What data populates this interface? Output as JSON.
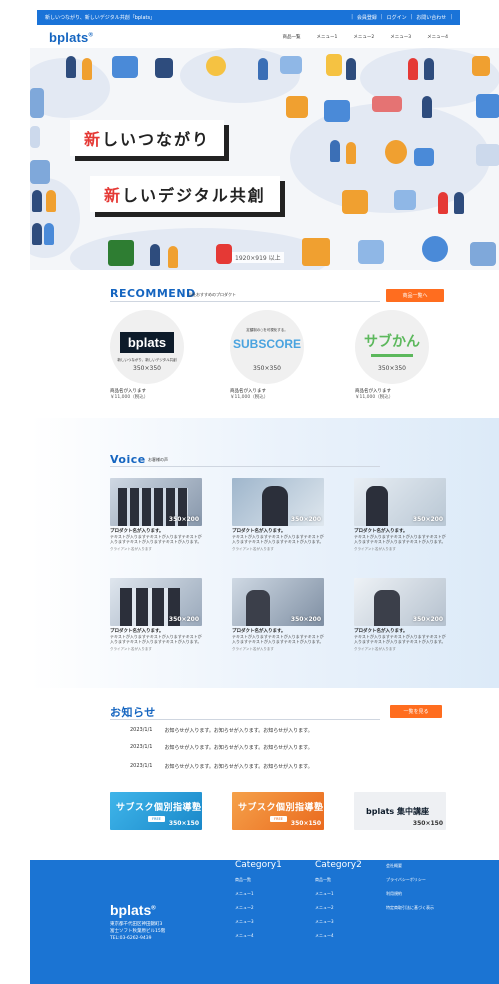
{
  "topbar": {
    "tagline": "新しいつながり、新しいデジタル共創「bplats」",
    "links": [
      "会員登録",
      "ログイン",
      "お問い合わせ"
    ]
  },
  "nav": {
    "logo": "bplats",
    "logo_mark": "®",
    "items": [
      "商品一覧",
      "メニュー1",
      "メニュー2",
      "メニュー3",
      "メニュー4"
    ]
  },
  "hero": {
    "headline1_accent": "新",
    "headline1_rest": "しいつながり",
    "headline2_accent": "新",
    "headline2_rest": "しいデジタル共創",
    "dimension": "1920×919 以上"
  },
  "recommend": {
    "title": "RECOMMEND",
    "subtitle": "当社おすすめのプロダクト",
    "button": "商品一覧へ",
    "products": [
      {
        "label": "bplats",
        "sub": "新しいつながり、新しいデジタル共創",
        "size": "350×350",
        "name": "商品名が入ります",
        "price": "￥11,000（税込）"
      },
      {
        "label": "SUBSCORE",
        "sub": "定額制の○を可視化する。",
        "size": "350×350",
        "name": "商品名が入ります",
        "price": "￥11,000（税込）"
      },
      {
        "label": "サブかん",
        "sub": "",
        "size": "350×350",
        "name": "商品名が入ります",
        "price": "￥11,000（税込）"
      }
    ]
  },
  "voice": {
    "title": "Voice",
    "subtitle": "お客様の声",
    "cards": [
      {
        "size": "350×200",
        "title": "プロダクト名が入ります。",
        "text": "テキストが入りますテキストが入りますテキストが入りますテキストが入りますテキストが入ります。",
        "category": "クライアント名が入ります"
      },
      {
        "size": "350×200",
        "title": "プロダクト名が入ります。",
        "text": "テキストが入りますテキストが入りますテキストが入りますテキストが入りますテキストが入ります。",
        "category": "クライアント名が入ります"
      },
      {
        "size": "350×200",
        "title": "プロダクト名が入ります。",
        "text": "テキストが入りますテキストが入りますテキストが入りますテキストが入りますテキストが入ります。",
        "category": "クライアント名が入ります"
      },
      {
        "size": "350×200",
        "title": "プロダクト名が入ります。",
        "text": "テキストが入りますテキストが入りますテキストが入りますテキストが入りますテキストが入ります。",
        "category": "クライアント名が入ります"
      },
      {
        "size": "350×200",
        "title": "プロダクト名が入ります。",
        "text": "テキストが入りますテキストが入りますテキストが入りますテキストが入りますテキストが入ります。",
        "category": "クライアント名が入ります"
      },
      {
        "size": "350×200",
        "title": "プロダクト名が入ります。",
        "text": "テキストが入りますテキストが入りますテキストが入りますテキストが入りますテキストが入ります。",
        "category": "クライアント名が入ります"
      }
    ]
  },
  "news": {
    "title": "お知らせ",
    "button": "一覧を見る",
    "items": [
      {
        "date": "2023/1/1",
        "text": "お知らせが入ります。お知らせが入ります。お知らせが入ります。"
      },
      {
        "date": "2023/1/1",
        "text": "お知らせが入ります。お知らせが入ります。お知らせが入ります。"
      },
      {
        "date": "2023/1/1",
        "text": "お知らせが入ります。お知らせが入ります。お知らせが入ります。"
      }
    ]
  },
  "banners": [
    {
      "text": "サブスク個別指導塾",
      "pill": "FREE",
      "size": "350×150",
      "color": "#22a3dc"
    },
    {
      "text": "サブスク個別指導塾",
      "pill": "FREE",
      "size": "350×150",
      "color": "#f07b2a"
    },
    {
      "text": "bplats 集中講座",
      "pill": "",
      "size": "350×150",
      "color": "#eef0f3"
    }
  ],
  "footer": {
    "logo": "bplats",
    "logo_mark": "®",
    "address": [
      "東京都千代田区神田錦町3",
      "富士ソフト秋葉原ビル15階",
      "TEL:03-6262-9439"
    ],
    "cat1": {
      "title": "Category1",
      "items": [
        "商品一覧",
        "メニュー1",
        "メニュー2",
        "メニュー3",
        "メニュー4"
      ]
    },
    "cat2": {
      "title": "Category2",
      "items": [
        "商品一覧",
        "メニュー1",
        "メニュー2",
        "メニュー3",
        "メニュー4"
      ]
    },
    "links": [
      "会社概要",
      "プライバシーポリシー",
      "利用規約",
      "特定商取引法に基づく表示"
    ]
  },
  "colors": {
    "brand": "#1565c0",
    "topbar": "#1a73d8",
    "accent": "#ff6d1f",
    "footer": "#1b74d3"
  }
}
